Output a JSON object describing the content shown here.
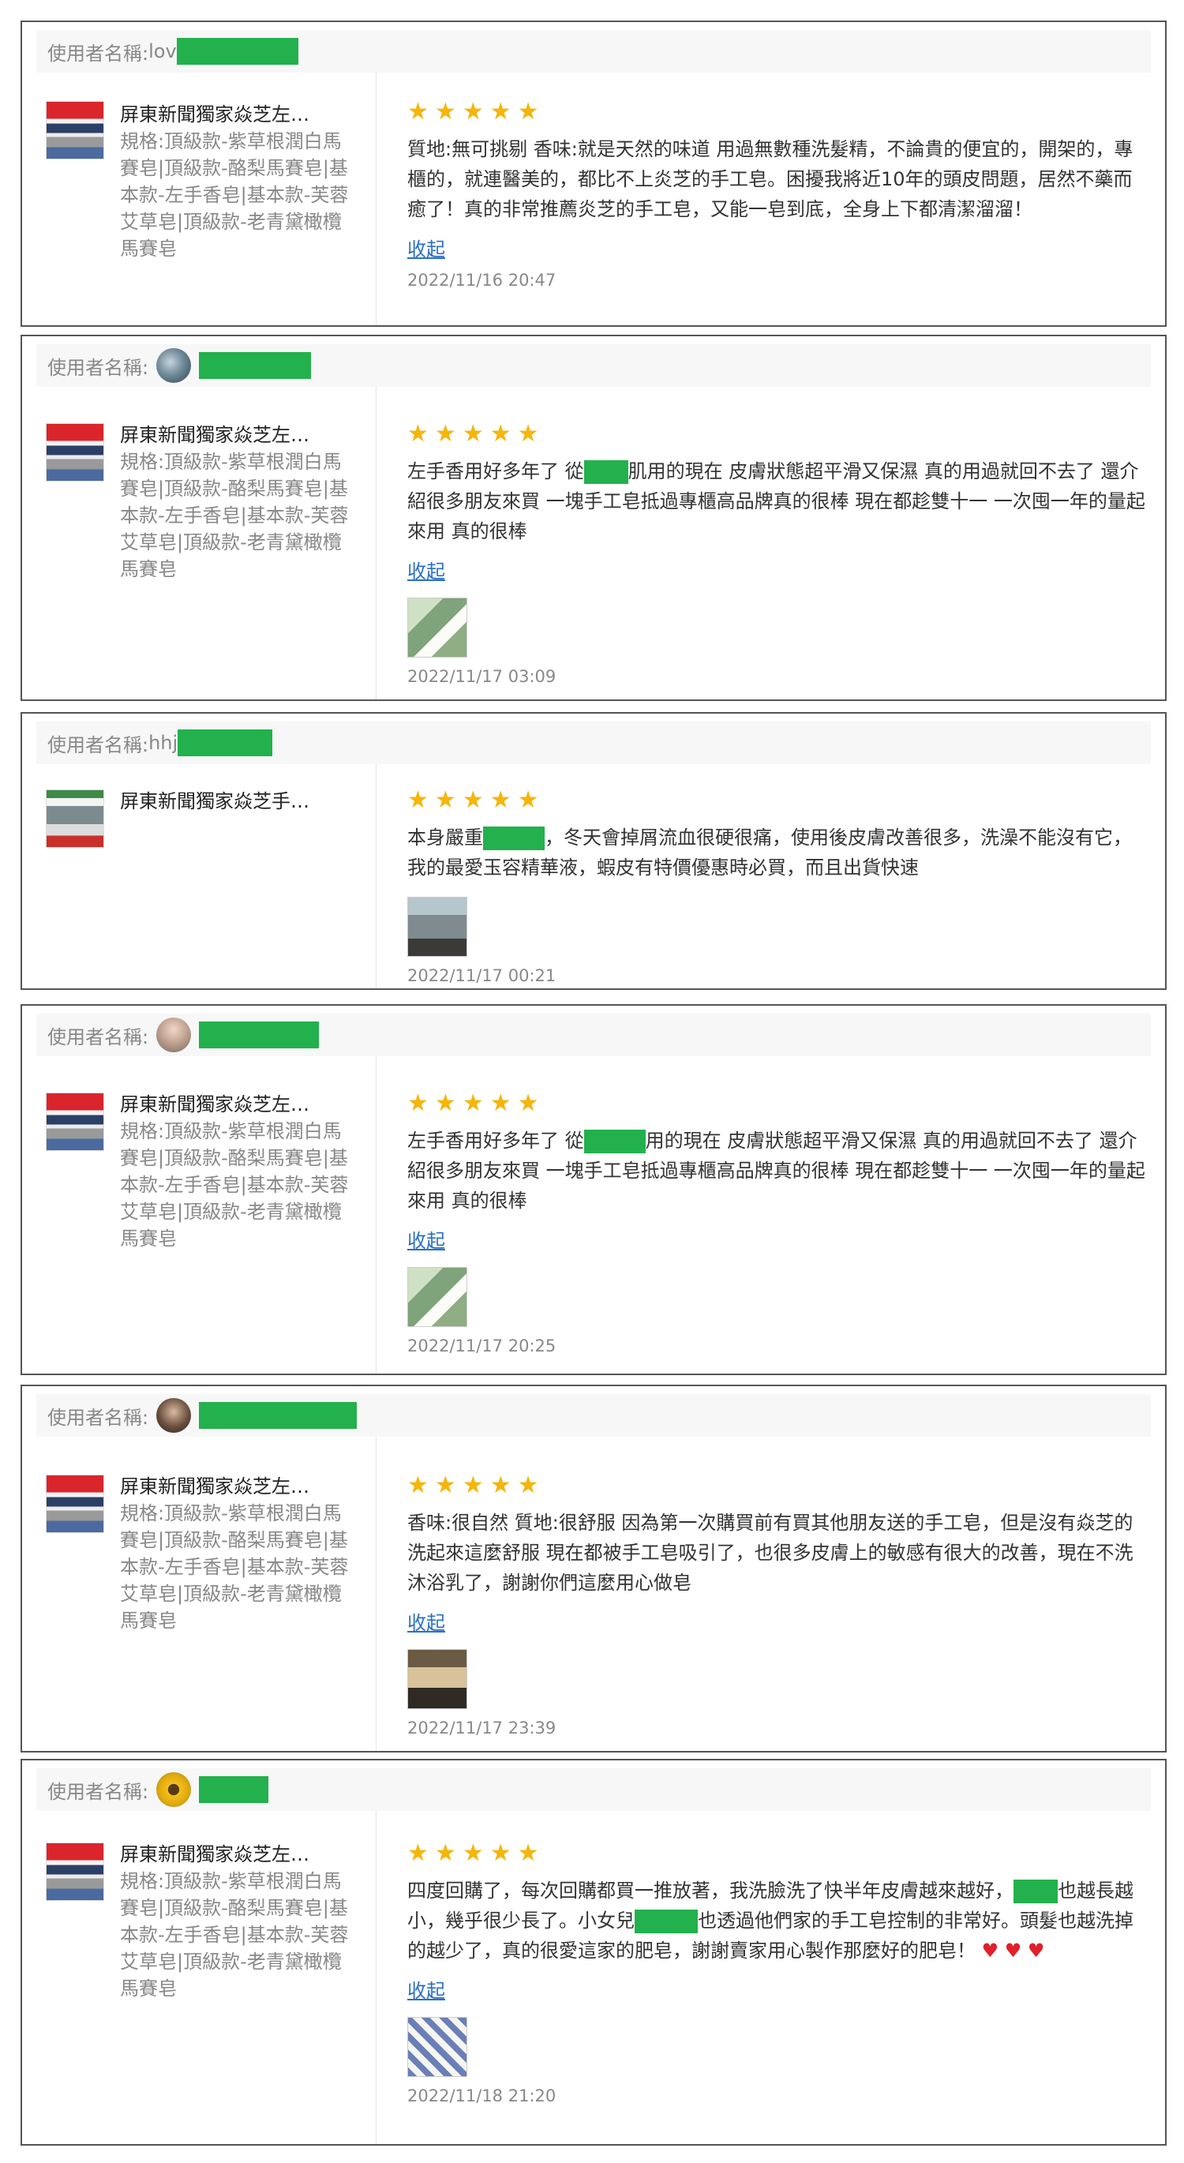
{
  "username_label": "使用者名稱:",
  "collapse_label": "收起",
  "stars": [
    "★",
    "★",
    "★",
    "★",
    "★"
  ],
  "colors": {
    "star": "#f5b50a",
    "link": "#2a6fc9",
    "redaction": "#22b14c",
    "heart": "#e0202a"
  },
  "reviews": [
    {
      "user_prefix": "lov",
      "product_name": "屏東新聞獨家焱芝左…",
      "spec": "規格:頂級款-紫草根潤白馬賽皂|頂級款-酪梨馬賽皂|基本款-左手香皂|基本款-芙蓉艾草皂|頂級款-老青黛橄欖馬賽皂",
      "comment": "質地:無可挑剔 香味:就是天然的味道 用過無數種洗髮精，不論貴的便宜的，開架的，專櫃的，就連醫美的，都比不上炎芝的手工皂。困擾我將近10年的頭皮問題，居然不藥而癒了！真的非常推薦炎芝的手工皂，又能一皂到底，全身上下都清潔溜溜！",
      "date": "2022/11/16 20:47"
    },
    {
      "user_prefix": "",
      "product_name": "屏東新聞獨家焱芝左…",
      "spec": "規格:頂級款-紫草根潤白馬賽皂|頂級款-酪梨馬賽皂|基本款-左手香皂|基本款-芙蓉艾草皂|頂級款-老青黛橄欖馬賽皂",
      "comment_a": "左手香用好多年了 從",
      "comment_b": "肌用的現在 皮膚狀態超平滑又保濕 真的用過就回不去了 還介紹很多朋友來買 一塊手工皂抵過專櫃高品牌真的很棒 現在都趁雙十一 一次囤一年的量起來用 真的很棒",
      "date": "2022/11/17 03:09"
    },
    {
      "user_prefix": "hhj",
      "product_name": "屏東新聞獨家焱芝手…",
      "comment_a": "本身嚴重",
      "comment_b": "，冬天會掉屑流血很硬很痛，使用後皮膚改善很多，洗澡不能沒有它，我的最愛玉容精華液，蝦皮有特價優惠時必買，而且出貨快速",
      "date": "2022/11/17 00:21"
    },
    {
      "user_prefix": "",
      "product_name": "屏東新聞獨家焱芝左…",
      "spec": "規格:頂級款-紫草根潤白馬賽皂|頂級款-酪梨馬賽皂|基本款-左手香皂|基本款-芙蓉艾草皂|頂級款-老青黛橄欖馬賽皂",
      "comment_a": "左手香用好多年了 從",
      "comment_b": "用的現在 皮膚狀態超平滑又保濕 真的用過就回不去了 還介紹很多朋友來買 一塊手工皂抵過專櫃高品牌真的很棒 現在都趁雙十一 一次囤一年的量起來用 真的很棒",
      "date": "2022/11/17 20:25"
    },
    {
      "user_prefix": "",
      "product_name": "屏東新聞獨家焱芝左…",
      "spec": "規格:頂級款-紫草根潤白馬賽皂|頂級款-酪梨馬賽皂|基本款-左手香皂|基本款-芙蓉艾草皂|頂級款-老青黛橄欖馬賽皂",
      "comment": "香味:很自然 質地:很舒服 因為第一次購買前有買其他朋友送的手工皂，但是沒有焱芝的洗起來這麼舒服 現在都被手工皂吸引了，也很多皮膚上的敏感有很大的改善，現在不洗沐浴乳了，謝謝你們這麼用心做皂",
      "date": "2022/11/17 23:39"
    },
    {
      "user_prefix": "",
      "product_name": "屏東新聞獨家焱芝左…",
      "spec": "規格:頂級款-紫草根潤白馬賽皂|頂級款-酪梨馬賽皂|基本款-左手香皂|基本款-芙蓉艾草皂|頂級款-老青黛橄欖馬賽皂",
      "comment_a": "四度回購了，每次回購都買一推放著，我洗臉洗了快半年皮膚越來越好，",
      "comment_b": "也越長越小，幾乎很少長了。小女兒",
      "comment_c": "也透過他們家的手工皂控制的非常好。頭髮也越洗掉的越少了，真的很愛這家的肥皂，謝謝賣家用心製作那麼好的肥皂！",
      "hearts": "♥ ♥ ♥",
      "date": "2022/11/18 21:20"
    }
  ]
}
